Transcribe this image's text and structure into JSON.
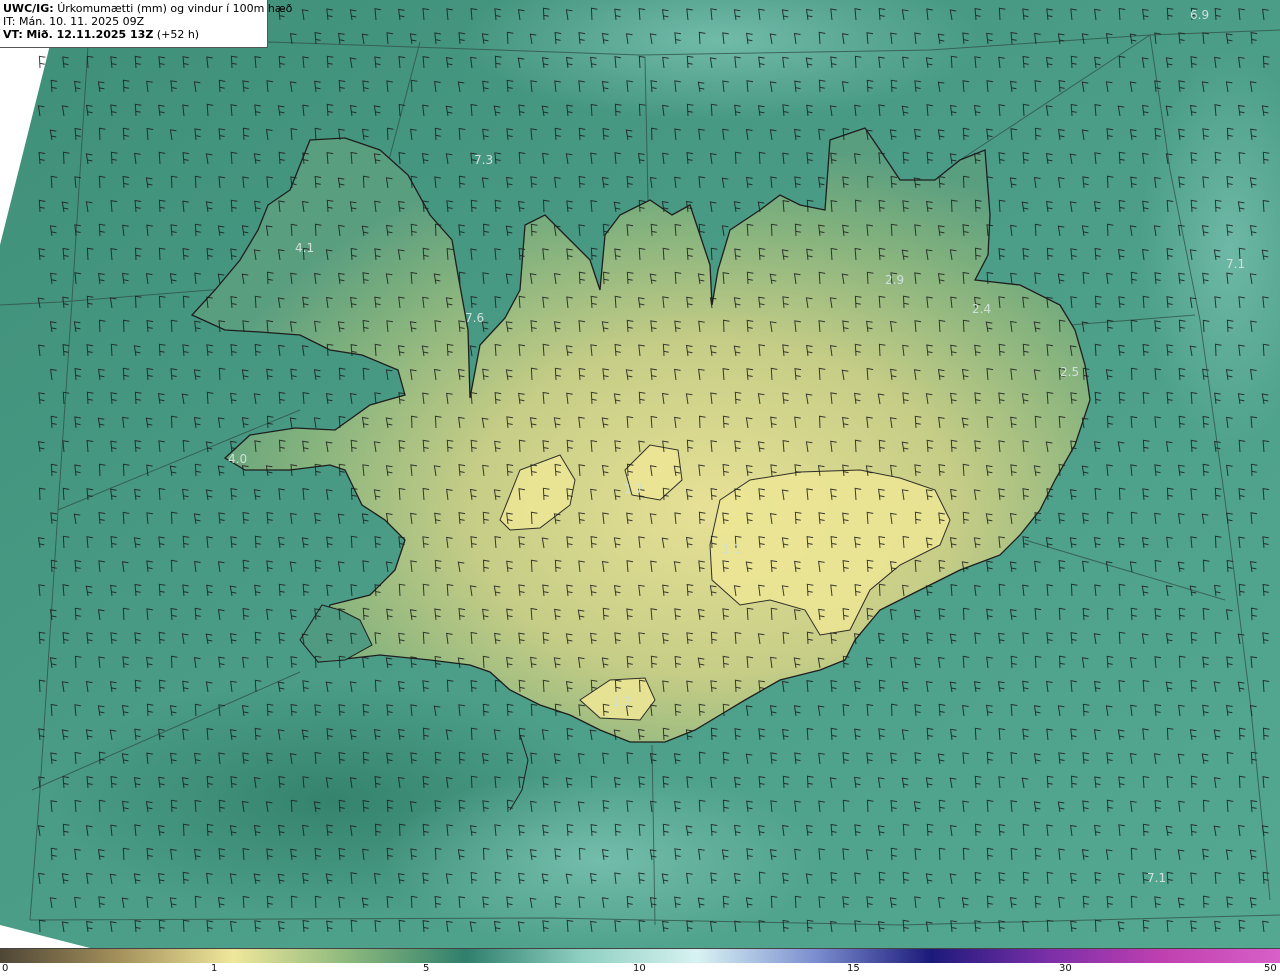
{
  "header": {
    "model_prefix": "UWC/IG:",
    "title": "Úrkomumætti (mm) og vindur í 100m hæð",
    "init_line": "IT: Mán. 10. 11. 2025 09Z",
    "valid_prefix": "VT:",
    "valid_time": "Mið. 12.11.2025 13Z",
    "lead_time": "(+52 h)"
  },
  "map_labels": [
    {
      "name": "label-northeast-corner",
      "text": "6.9"
    },
    {
      "name": "label-west-fjords-north",
      "text": "7.3"
    },
    {
      "name": "label-west-fjords",
      "text": "4.1"
    },
    {
      "name": "label-breidafjordur",
      "text": "7.6"
    },
    {
      "name": "label-snaefellsnes",
      "text": "4.0"
    },
    {
      "name": "label-north-central",
      "text": "2.9"
    },
    {
      "name": "label-northeast",
      "text": "2.4"
    },
    {
      "name": "label-east-fjords",
      "text": "2.5"
    },
    {
      "name": "label-far-east",
      "text": "7.1"
    },
    {
      "name": "label-hofsjokull",
      "text": "1.7"
    },
    {
      "name": "label-vatnajokull",
      "text": "1.1"
    },
    {
      "name": "label-south",
      "text": "1.7"
    },
    {
      "name": "label-southeast-sea",
      "text": "7.1"
    }
  ],
  "colorbar": {
    "ticks": [
      "0",
      "1",
      "5",
      "10",
      "15",
      "30",
      "50"
    ],
    "stops": [
      "#4f4636",
      "#a28f5a",
      "#efe79a",
      "#8bb87d",
      "#2f7f6d",
      "#8fd0c2",
      "#d8f2f2",
      "#7c8fd0",
      "#1c1a7a",
      "#7a2fa8",
      "#c040b0",
      "#d860c8"
    ]
  },
  "colors": {
    "sea_base": "#4b9c86",
    "land_high": "#e9e39a",
    "coastline": "#1e1e1e"
  }
}
